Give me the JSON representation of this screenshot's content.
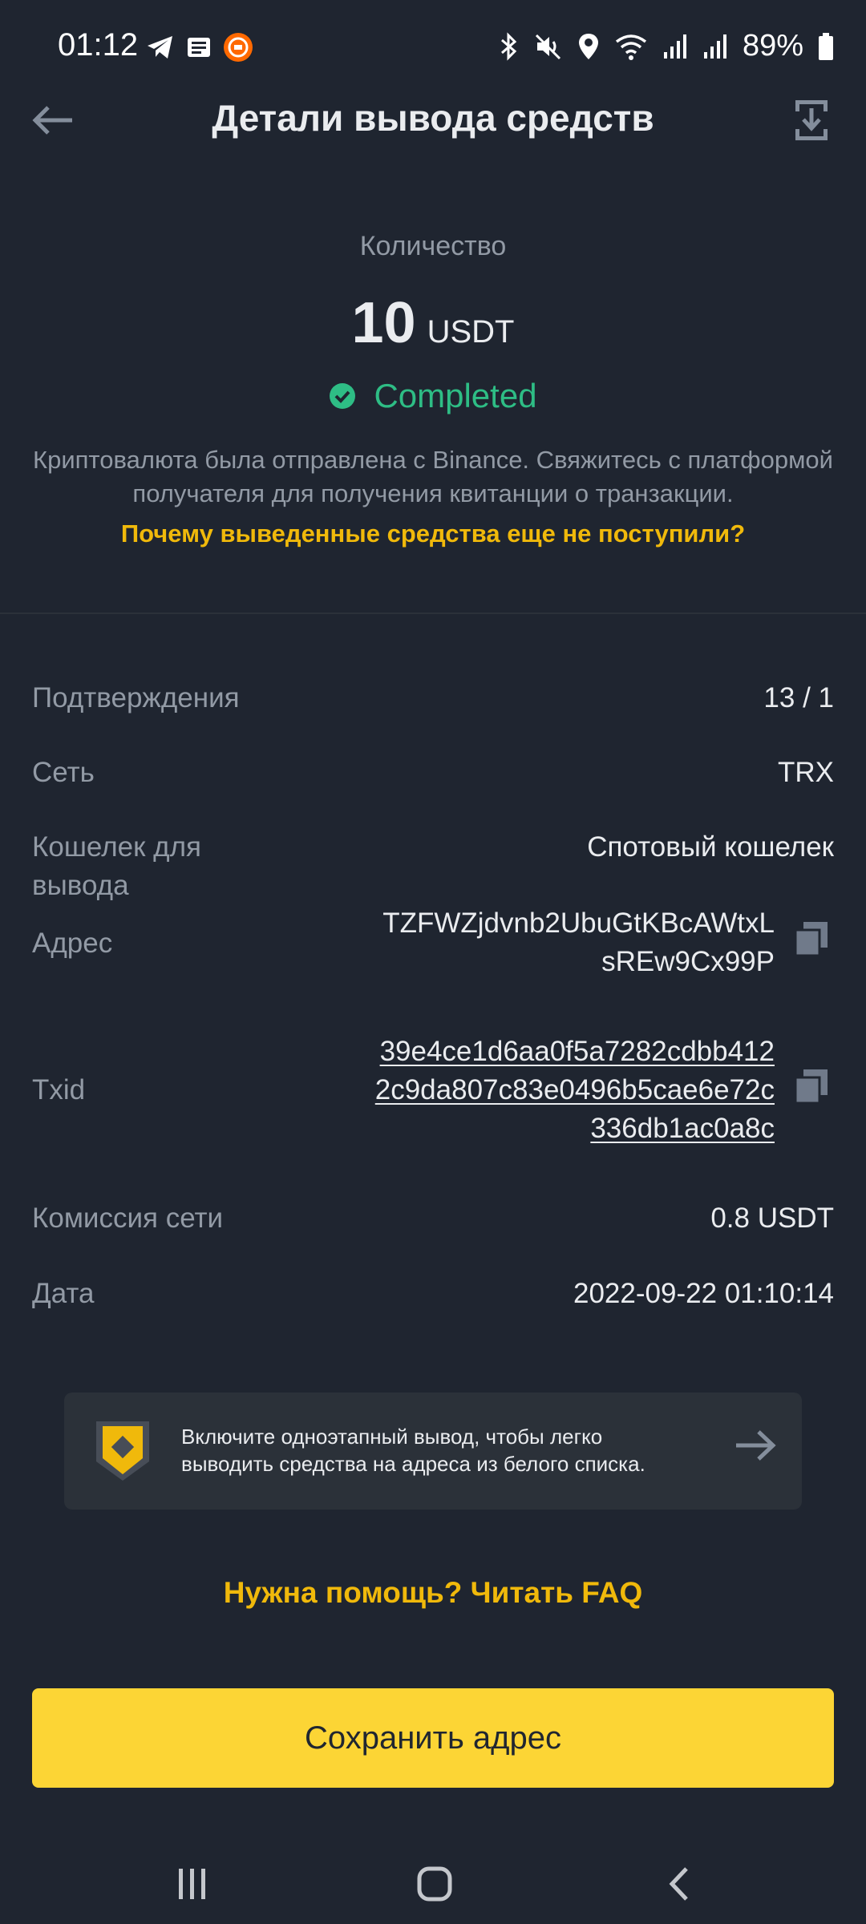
{
  "status_bar": {
    "time": "01:12",
    "battery": "89%",
    "icons_left": [
      "telegram-icon",
      "news-icon",
      "mi-app-icon"
    ],
    "icons_right": [
      "bluetooth-icon",
      "mute-icon",
      "location-icon",
      "wifi-icon",
      "signal-icon",
      "signal-icon",
      "battery-icon"
    ]
  },
  "header": {
    "title": "Детали вывода средств"
  },
  "summary": {
    "amount_label": "Количество",
    "amount_value": "10",
    "amount_unit": "USDT",
    "status": "Completed",
    "description": "Криптовалюта была отправлена с Binance. Свяжитесь с платформой получателя для получения квитанции о транзакции.",
    "why_link": "Почему выведенные средства еще не поступили?"
  },
  "details": {
    "confirmations_label": "Подтверждения",
    "confirmations_value": "13 / 1",
    "network_label": "Сеть",
    "network_value": "TRX",
    "wallet_label_line1": "Кошелек для",
    "wallet_label_line2": "вывода",
    "wallet_value": "Спотовый кошелек",
    "address_label": "Адрес",
    "address_line1": "TZFWZjdvnb2UbuGtKBcAWtxL",
    "address_line2": "sREw9Cx99P",
    "txid_label": "Txid",
    "txid_line1": "39e4ce1d6aa0f5a7282cdbb412",
    "txid_line2": "2c9da807c83e0496b5cae6e72c",
    "txid_line3": "336db1ac0a8c",
    "fee_label": "Комиссия сети",
    "fee_value": "0.8 USDT",
    "date_label": "Дата",
    "date_value": "2022-09-22 01:10:14"
  },
  "banner": {
    "text_line1": "Включите одноэтапный вывод, чтобы легко",
    "text_line2": "выводить средства на адреса из белого списка."
  },
  "faq_link": "Нужна помощь? Читать FAQ",
  "save_button": "Сохранить адрес",
  "colors": {
    "background": "#1f2530",
    "accent_yellow": "#fcd535",
    "link_yellow": "#f0b90b",
    "success_green": "#2ebd85",
    "muted_text": "#929aa5"
  }
}
